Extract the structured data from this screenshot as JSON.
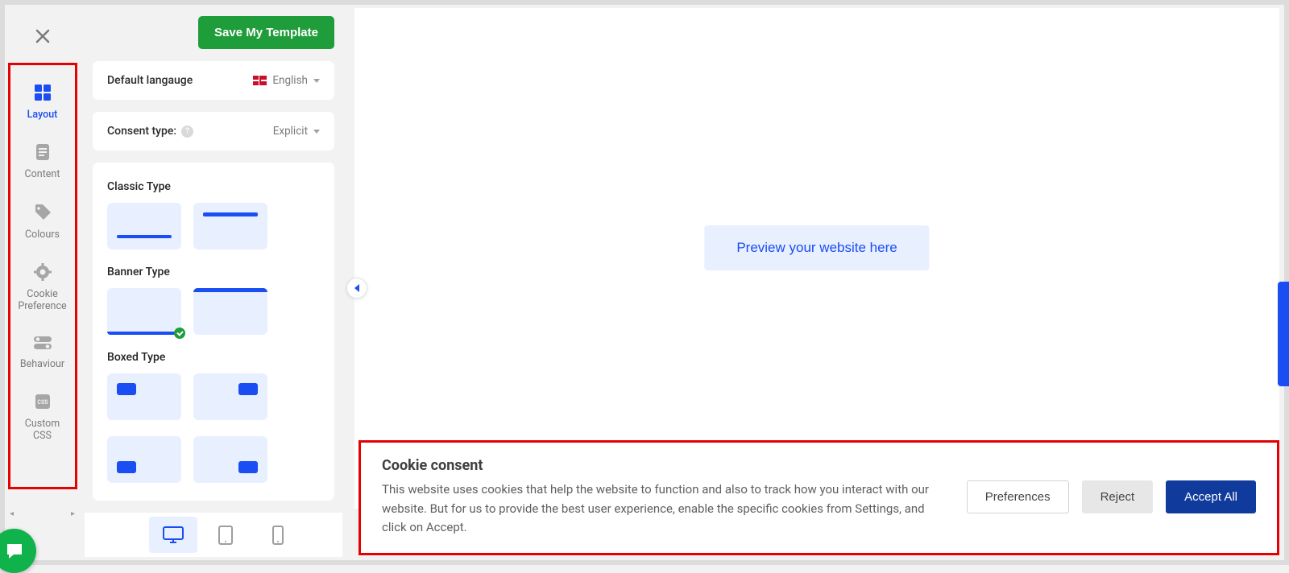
{
  "sidebar": {
    "items": [
      {
        "label": "Layout",
        "icon": "grid-icon",
        "active": true
      },
      {
        "label": "Content",
        "icon": "document-icon",
        "active": false
      },
      {
        "label": "Colours",
        "icon": "tag-icon",
        "active": false
      },
      {
        "label": "Cookie\nPreference",
        "icon": "gear-icon",
        "active": false
      },
      {
        "label": "Behaviour",
        "icon": "toggles-icon",
        "active": false
      },
      {
        "label": "Custom\nCSS",
        "icon": "css-icon",
        "active": false
      }
    ]
  },
  "toolbar": {
    "save_label": "Save My Template"
  },
  "settings": {
    "default_language_label": "Default langauge",
    "default_language_value": "English",
    "consent_type_label": "Consent type:",
    "consent_type_value": "Explicit",
    "sections": {
      "classic": "Classic Type",
      "banner": "Banner Type",
      "boxed": "Boxed Type"
    },
    "selected_template": "banner-bottom"
  },
  "preview": {
    "button_label": "Preview your website here"
  },
  "device_bar": {
    "devices": [
      "desktop",
      "tablet",
      "mobile"
    ],
    "active": "desktop"
  },
  "cookie_banner": {
    "title": "Cookie consent",
    "body": "This website uses cookies that help the website to function and also to track how you interact with our website. But for us to provide the best user experience, enable the specific cookies from Settings, and click on Accept.",
    "preferences_label": "Preferences",
    "reject_label": "Reject",
    "accept_label": "Accept All"
  }
}
